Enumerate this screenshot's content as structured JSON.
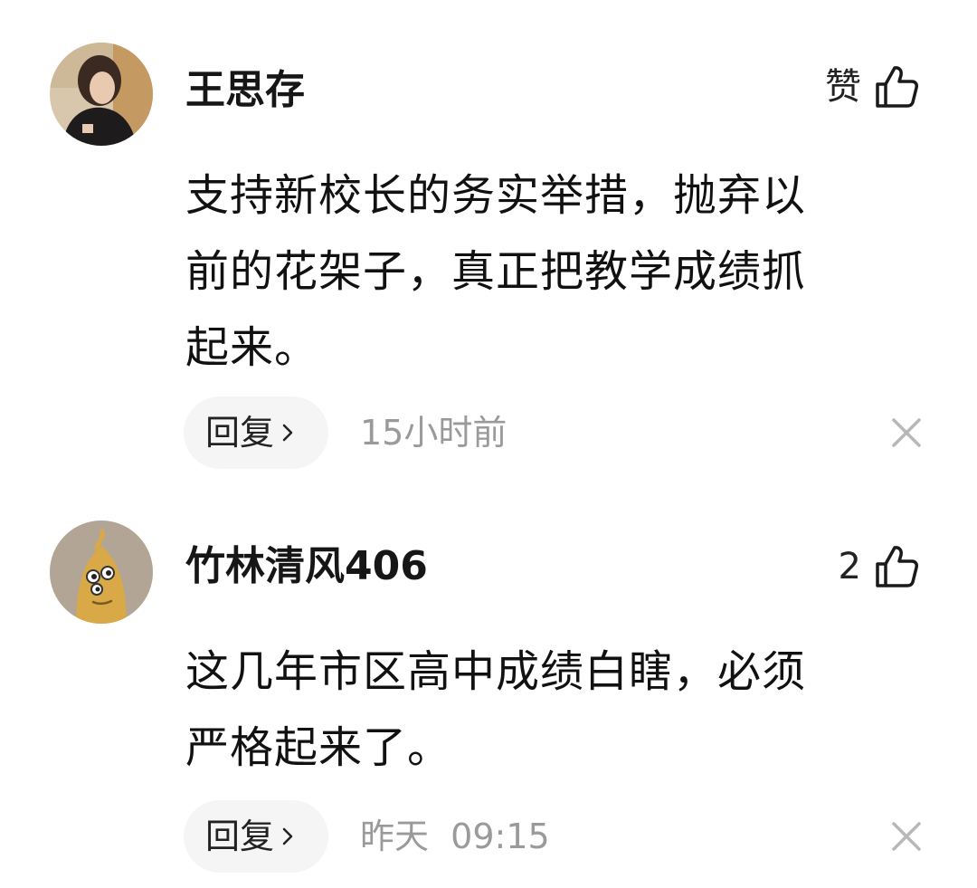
{
  "comments": [
    {
      "username": "王思存",
      "like_label": "赞",
      "text_lines": [
        "支持新校长的务实举措，抛弃以",
        "前的花架子，真正把教学成绩抓",
        "起来。"
      ],
      "reply_label": "回复",
      "reply_chevron": "›",
      "timestamp": "15小时前",
      "avatar_icon": "user-photo-avatar",
      "like_icon": "thumbs-up-icon",
      "close_icon": "close-icon"
    },
    {
      "username": "竹林清风406",
      "like_label": "2",
      "text_lines": [
        "这几年市区高中成绩白瞎，必须",
        "严格起来了。"
      ],
      "reply_label": "回复",
      "reply_chevron": "›",
      "timestamp": "昨天  09:15",
      "avatar_icon": "cartoon-avatar",
      "like_icon": "thumbs-up-icon",
      "close_icon": "close-icon"
    }
  ],
  "colors": {
    "text_primary": "#111111",
    "text_secondary": "#9a9a9a",
    "pill_background": "#f5f5f5",
    "close_icon": "#b8b8b8"
  }
}
